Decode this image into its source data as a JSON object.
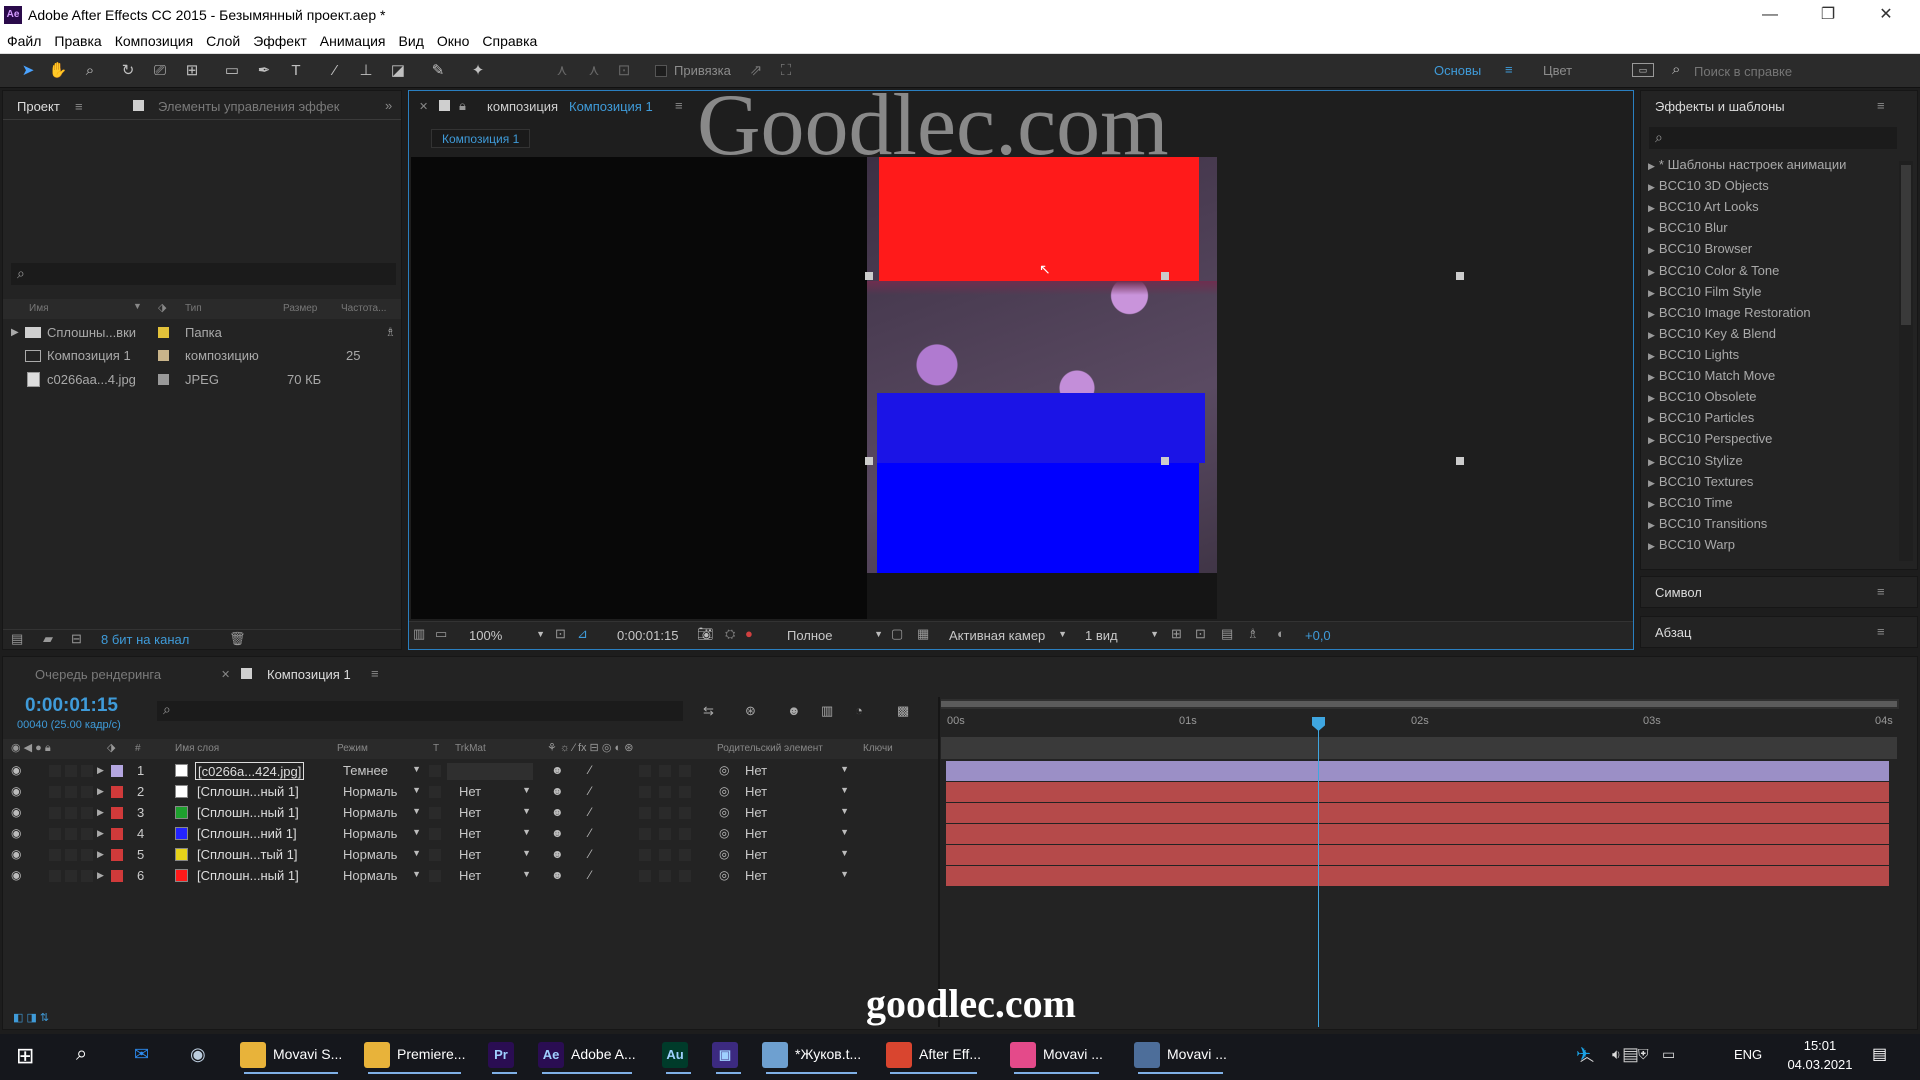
{
  "window": {
    "app_icon": "Ae",
    "title": "Adobe After Effects CC 2015 - Безымянный проект.aep *",
    "minimize": "—",
    "restore": "❐",
    "close": "✕"
  },
  "menu": [
    "Файл",
    "Правка",
    "Композиция",
    "Слой",
    "Эффект",
    "Анимация",
    "Вид",
    "Окно",
    "Справка"
  ],
  "toolbar": {
    "snapping_label": "Привязка",
    "workspace_basic": "Основы",
    "workspace_color": "Цвет",
    "help_search_placeholder": "Поиск в справке"
  },
  "watermarks": {
    "top": "Goodlec.com",
    "bottom": "goodlec.com"
  },
  "project_panel": {
    "tab_project": "Проект",
    "tab_effect_controls": "Элементы управления эффек",
    "columns": {
      "name": "Имя",
      "type": "Тип",
      "size": "Размер",
      "rate": "Частота..."
    },
    "items": [
      {
        "name": "Сплошны...вки",
        "type": "Папка",
        "size": "",
        "rate": ""
      },
      {
        "name": "Композиция 1",
        "type": "композицию",
        "size": "",
        "rate": "25"
      },
      {
        "name": "c0266aa...4.jpg",
        "type": "JPEG",
        "size": "70 КБ",
        "rate": ""
      }
    ],
    "bit_depth": "8 бит на канал"
  },
  "composition_panel": {
    "tab_prefix": "композиция",
    "tab_name": "Композиция 1",
    "breadcrumb": "Композиция 1",
    "zoom": "100%",
    "timecode": "0:00:01:15",
    "resolution": "Полное",
    "camera": "Активная камер",
    "views": "1 вид",
    "exposure": "+0,0"
  },
  "effects_panel": {
    "title": "Эффекты и шаблоны",
    "items": [
      "* Шаблоны настроек анимации",
      "BCC10 3D Objects",
      "BCC10 Art Looks",
      "BCC10 Blur",
      "BCC10 Browser",
      "BCC10 Color & Tone",
      "BCC10 Film Style",
      "BCC10 Image Restoration",
      "BCC10 Key & Blend",
      "BCC10 Lights",
      "BCC10 Match Move",
      "BCC10 Obsolete",
      "BCC10 Particles",
      "BCC10 Perspective",
      "BCC10 Stylize",
      "BCC10 Textures",
      "BCC10 Time",
      "BCC10 Transitions",
      "BCC10 Warp"
    ],
    "symbol_panel": "Символ",
    "paragraph_panel": "Абзац"
  },
  "timeline": {
    "tab_render_queue": "Очередь рендеринга",
    "tab_comp": "Композиция 1",
    "timecode": "0:00:01:15",
    "frame_info": "00040 (25.00 кадр/с)",
    "columns": {
      "num": "#",
      "layer_name": "Имя слоя",
      "mode": "Режим",
      "t": "T",
      "trkmat": "TrkMat",
      "parent": "Родительский элемент",
      "keys": "Ключи"
    },
    "ruler": [
      "00s",
      "01s",
      "02s",
      "03s",
      "04s"
    ],
    "playhead_fraction": 0.4,
    "layers": [
      {
        "num": "1",
        "label_color": "#b4a6e0",
        "swatch": "#ffffff",
        "name": "[c0266a...424.jpg]",
        "mode": "Темнее",
        "trkmat": "",
        "parent": "Нет",
        "bar_color": "#9b8fc6"
      },
      {
        "num": "2",
        "label_color": "#d03a3a",
        "swatch": "#ffffff",
        "name": "[Сплошн...ный 1]",
        "mode": "Нормаль",
        "trkmat": "Нет",
        "parent": "Нет",
        "bar_color": "#b54a4a"
      },
      {
        "num": "3",
        "label_color": "#d03a3a",
        "swatch": "#1ea02e",
        "name": "[Сплошн...ный 1]",
        "mode": "Нормаль",
        "trkmat": "Нет",
        "parent": "Нет",
        "bar_color": "#b54a4a"
      },
      {
        "num": "4",
        "label_color": "#d03a3a",
        "swatch": "#2323ff",
        "name": "[Сплошн...ний 1]",
        "mode": "Нормаль",
        "trkmat": "Нет",
        "parent": "Нет",
        "bar_color": "#b54a4a"
      },
      {
        "num": "5",
        "label_color": "#d03a3a",
        "swatch": "#e6d21a",
        "name": "[Сплошн...тый 1]",
        "mode": "Нормаль",
        "trkmat": "Нет",
        "parent": "Нет",
        "bar_color": "#b54a4a"
      },
      {
        "num": "6",
        "label_color": "#d03a3a",
        "swatch": "#ff1a1a",
        "name": "[Сплошн...ный 1]",
        "mode": "Нормаль",
        "trkmat": "Нет",
        "parent": "Нет",
        "bar_color": "#b54a4a"
      }
    ]
  },
  "taskbar": {
    "items": [
      {
        "label": "Movavi S...",
        "icon": "folder-icon",
        "color": "#e8b33a"
      },
      {
        "label": "Premiere...",
        "icon": "folder-icon",
        "color": "#e8b33a"
      },
      {
        "label": "",
        "icon": "premiere-icon",
        "text": "Pr",
        "color": "#2a0d52"
      },
      {
        "label": "Adobe A...",
        "icon": "after-effects-icon",
        "text": "Ae",
        "color": "#2a0d52"
      },
      {
        "label": "",
        "icon": "audition-icon",
        "text": "Au",
        "color": "#003b2a"
      },
      {
        "label": "",
        "icon": "visual-studio-icon",
        "text": "▣",
        "color": "#3c2a80"
      },
      {
        "label": "*Жуков.t...",
        "icon": "notepad-icon",
        "color": "#6ea0d0"
      },
      {
        "label": "After Eff...",
        "icon": "chrome-icon",
        "color": "#d9452f"
      },
      {
        "label": "Movavi ...",
        "icon": "movavi-icon",
        "color": "#e44a8a"
      },
      {
        "label": "Movavi ...",
        "icon": "movavi-video-icon",
        "color": "#4d6e9a"
      }
    ],
    "language": "ENG",
    "time": "15:01",
    "date": "04.03.2021"
  }
}
